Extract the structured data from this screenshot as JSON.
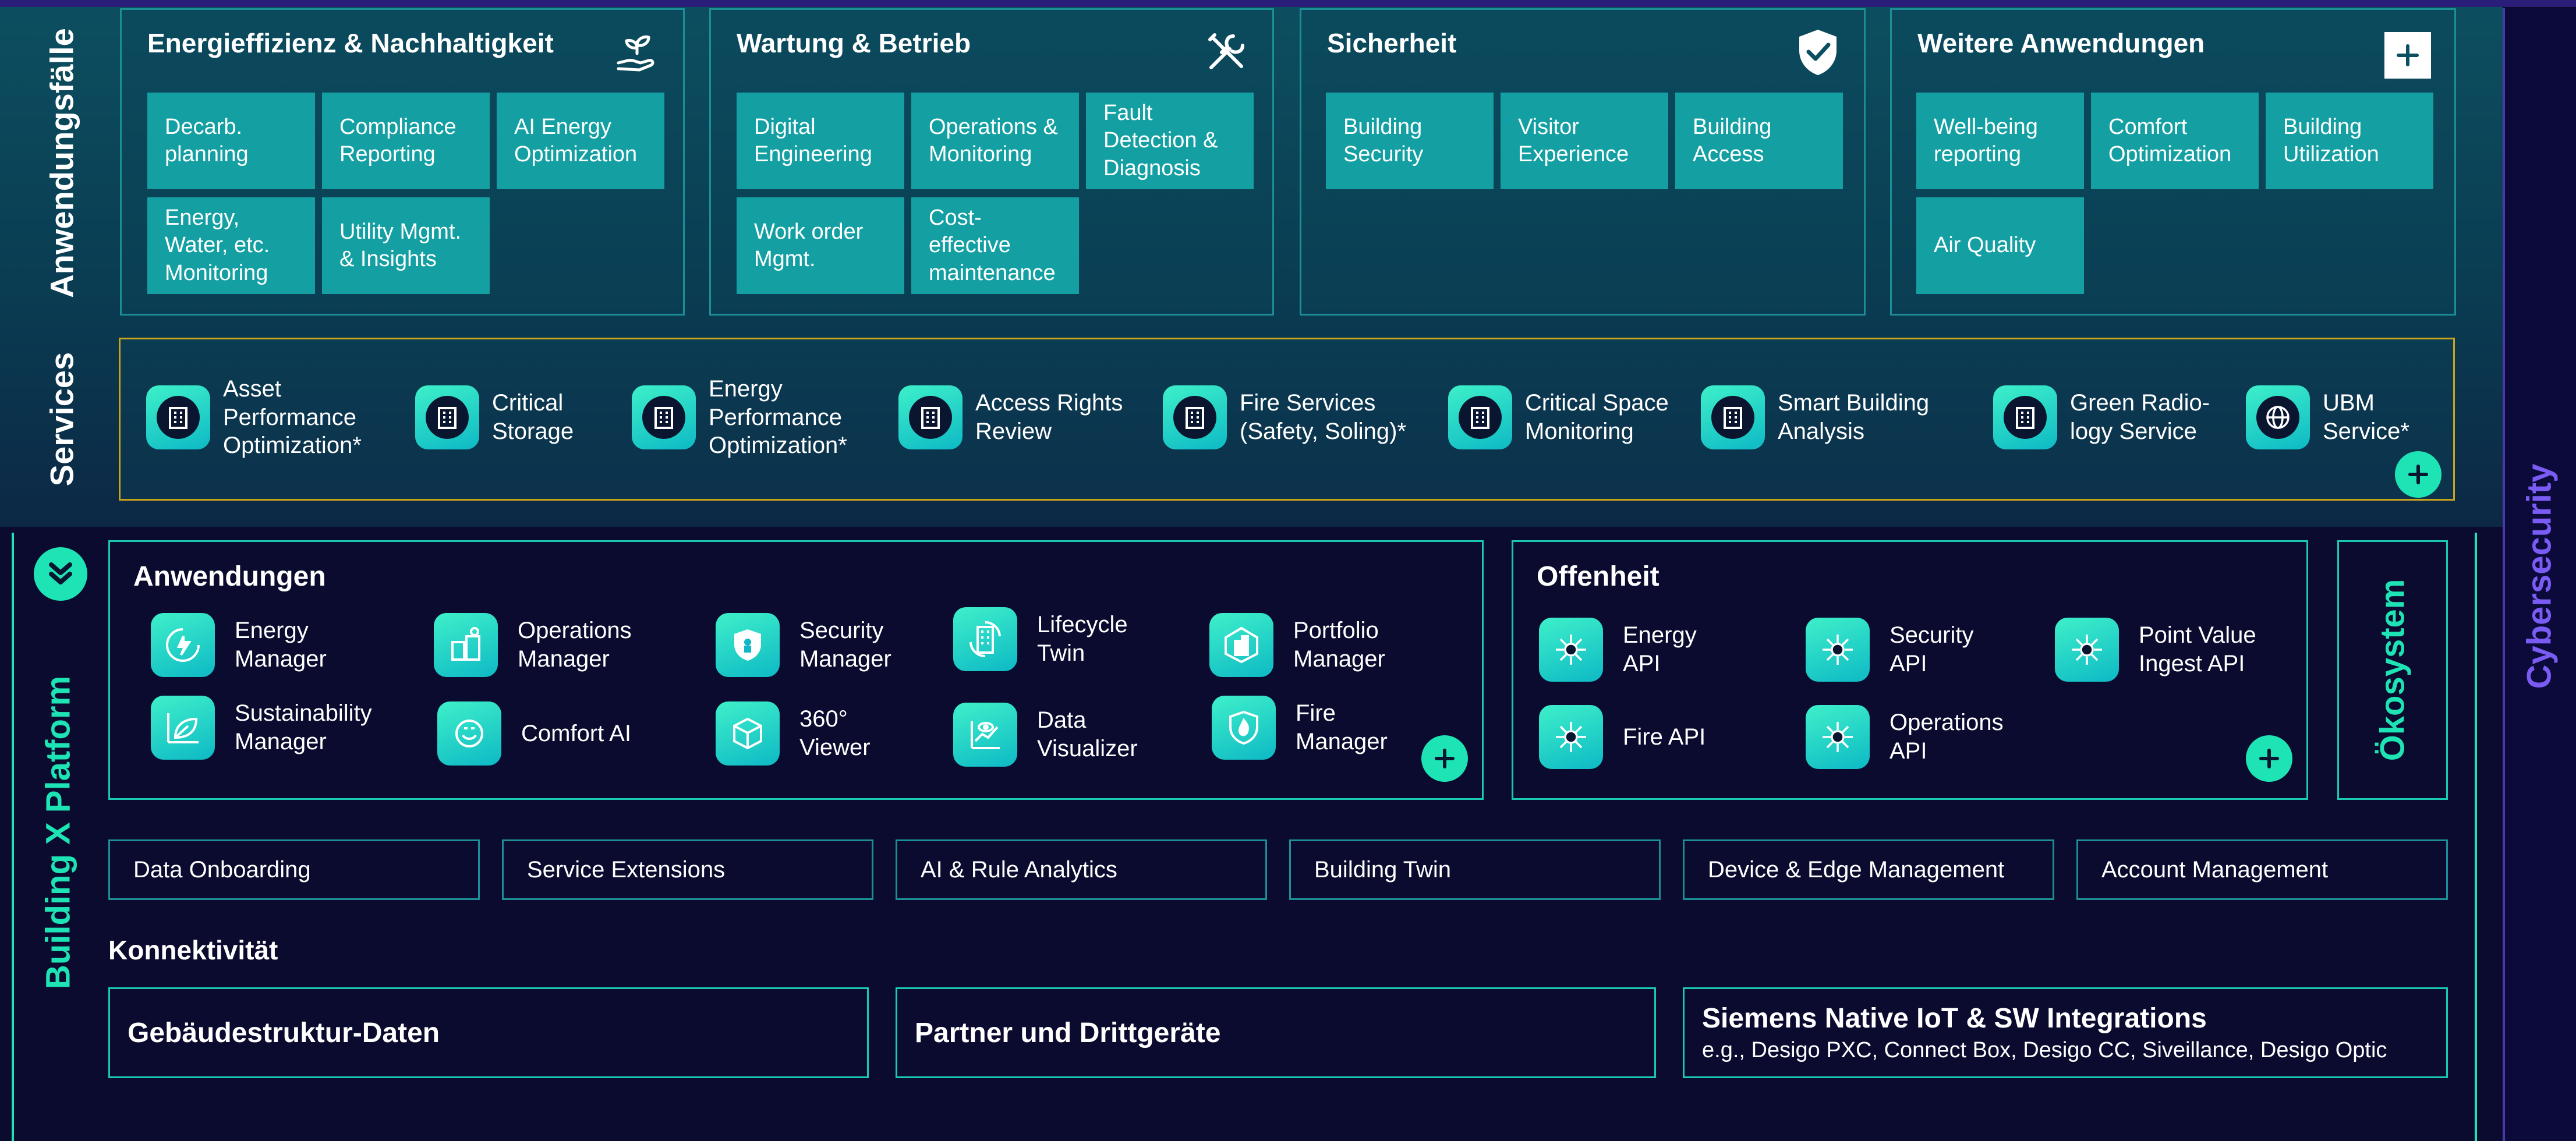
{
  "side_labels": {
    "anwendungsfaelle": "Anwendungsfälle",
    "services": "Services",
    "platform": "Building X Platform",
    "cybersecurity": "Cybersecurity"
  },
  "use_cases": [
    {
      "title": "Energieffizienz & Nachhaltigkeit",
      "icon": "plant-hand-icon",
      "tiles": [
        "Decarb. planning",
        "Compliance Reporting",
        "AI Energy Optimization",
        "Energy, Water, etc. Monitoring",
        "Utility Mgmt. & Insights"
      ]
    },
    {
      "title": "Wartung & Betrieb",
      "icon": "tools-icon",
      "tiles": [
        "Digital Engineering",
        "Operations & Monitoring",
        "Fault Detection & Diagnosis",
        "Work order Mgmt.",
        "Cost-effective maintenance"
      ]
    },
    {
      "title": "Sicherheit",
      "icon": "shield-check-icon",
      "tiles": [
        "Building Security",
        "Visitor Experience",
        "Building Access"
      ]
    },
    {
      "title": "Weitere Anwendungen",
      "icon": "plus-icon",
      "tiles": [
        "Well-being reporting",
        "Comfort Optimization",
        "Building Utilization",
        "Air Quality"
      ]
    }
  ],
  "services": [
    {
      "label": "Asset Performance Optimization*",
      "icon": "building-icon"
    },
    {
      "label": "Critical Storage",
      "icon": "building-icon"
    },
    {
      "label": "Energy Performance Optimization*",
      "icon": "building-icon"
    },
    {
      "label": "Access Rights Review",
      "icon": "building-icon"
    },
    {
      "label": "Fire Services (Safety, Soling)*",
      "icon": "building-icon"
    },
    {
      "label": "Critical Space Monitoring",
      "icon": "building-icon"
    },
    {
      "label": "Smart Building Analysis",
      "icon": "building-icon"
    },
    {
      "label": "Green Radio-logy Service",
      "icon": "building-icon"
    },
    {
      "label": "UBM Service*",
      "icon": "globe-icon"
    }
  ],
  "anwendungen": {
    "title": "Anwendungen",
    "apps": [
      {
        "label": "Energy Manager",
        "icon": "energy-icon"
      },
      {
        "label": "Operations Manager",
        "icon": "operations-icon"
      },
      {
        "label": "Security Manager",
        "icon": "security-icon"
      },
      {
        "label": "Lifecycle Twin",
        "icon": "lifecycle-icon"
      },
      {
        "label": "Portfolio Manager",
        "icon": "portfolio-icon"
      },
      {
        "label": "Sustainability Manager",
        "icon": "leaf-icon"
      },
      {
        "label": "Comfort AI",
        "icon": "comfort-icon"
      },
      {
        "label": "360° Viewer",
        "icon": "cube-icon"
      },
      {
        "label": "Data Visualizer",
        "icon": "chart-icon"
      },
      {
        "label": "Fire Manager",
        "icon": "fire-icon"
      }
    ]
  },
  "offenheit": {
    "title": "Offenheit",
    "apis": [
      {
        "label": "Energy API"
      },
      {
        "label": "Security API"
      },
      {
        "label": "Point Value Ingest API"
      },
      {
        "label": "Fire API"
      },
      {
        "label": "Operations API"
      }
    ]
  },
  "oekosystem": "Ökosystem",
  "capabilities": [
    "Data Onboarding",
    "Service Extensions",
    "AI & Rule Analytics",
    "Building Twin",
    "Device & Edge Management",
    "Account Management"
  ],
  "konnektivitaet": {
    "title": "Konnektivität",
    "boxes": [
      {
        "title": "Gebäudestruktur-Daten",
        "subtitle": ""
      },
      {
        "title": "Partner und Drittgeräte",
        "subtitle": ""
      },
      {
        "title": "Siemens Native IoT & SW Integrations",
        "subtitle": "e.g., Desigo PXC, Connect Box, Desigo CC, Siveillance, Desigo Optic"
      }
    ]
  },
  "colors": {
    "accent": "#1ee3b4",
    "cyber": "#7a5cf5",
    "tile": "#14a0a3",
    "services_border": "#c9a31e"
  }
}
